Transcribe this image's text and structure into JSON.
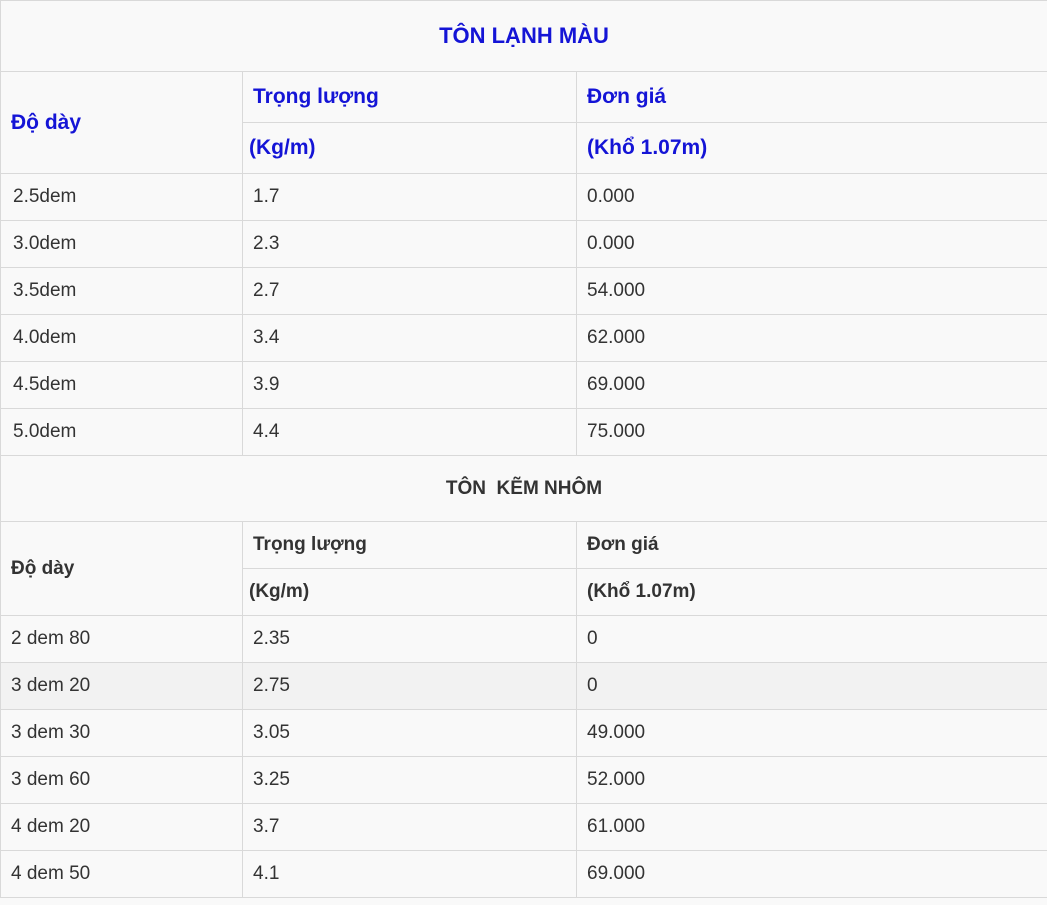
{
  "ton_lanh_mau": {
    "title": "TÔN LẠNH MÀU",
    "header": {
      "thickness": "Độ dày",
      "weight": "Trọng lượng",
      "weight_unit": "(Kg/m)",
      "price": "Đơn giá",
      "price_unit": "(Khổ 1.07m)"
    },
    "rows": [
      {
        "thickness": "2.5dem",
        "weight": "1.7",
        "price": "0.000"
      },
      {
        "thickness": "3.0dem",
        "weight": "2.3",
        "price": "0.000"
      },
      {
        "thickness": "3.5dem",
        "weight": "2.7",
        "price": "54.000"
      },
      {
        "thickness": "4.0dem",
        "weight": "3.4",
        "price": "62.000"
      },
      {
        "thickness": "4.5dem",
        "weight": "3.9",
        "price": "69.000"
      },
      {
        "thickness": "5.0dem",
        "weight": "4.4",
        "price": "75.000"
      }
    ]
  },
  "ton_kem_nhom": {
    "title": "TÔN  KẼM NHÔM",
    "header": {
      "thickness": "Độ dày",
      "weight": "Trọng lượng",
      "weight_unit": "(Kg/m)",
      "price": "Đơn giá",
      "price_unit": "(Khổ 1.07m)"
    },
    "rows": [
      {
        "thickness": "2 dem 80",
        "weight": "2.35",
        "price": "0"
      },
      {
        "thickness": "3 dem 20",
        "weight": "2.75",
        "price": "0"
      },
      {
        "thickness": "3 dem 30",
        "weight": "3.05",
        "price": "49.000"
      },
      {
        "thickness": "3 dem 60",
        "weight": "3.25",
        "price": "52.000"
      },
      {
        "thickness": "4 dem 20",
        "weight": "3.7",
        "price": "61.000"
      },
      {
        "thickness": "4 dem 50",
        "weight": "4.1",
        "price": "69.000"
      }
    ]
  },
  "colors": {
    "title_blue": "#1414d6",
    "text": "#333333",
    "border": "#d9d9d9",
    "background": "#f9f9f9"
  }
}
